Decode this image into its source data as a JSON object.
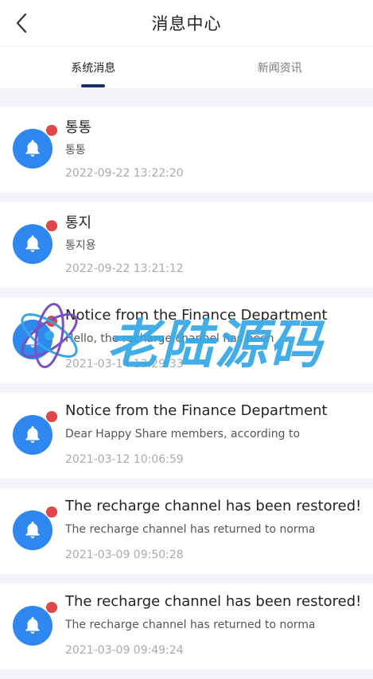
{
  "header": {
    "title": "消息中心",
    "back_icon": "chevron-left-icon"
  },
  "tabs": [
    {
      "label": "系统消息",
      "active": true
    },
    {
      "label": "新闻资讯",
      "active": false
    }
  ],
  "messages": [
    {
      "title": "통통",
      "preview": "통통",
      "time": "2022-09-22 13:22:20",
      "unread": true
    },
    {
      "title": "통지",
      "preview": "통지용",
      "time": "2022-09-22 13:21:12",
      "unread": true
    },
    {
      "title": "Notice from the Finance Department",
      "preview": "Hello, the recharge channel has been",
      "time": "2021-03-14 13:29:33",
      "unread": true
    },
    {
      "title": "Notice from the Finance Department",
      "preview": "Dear Happy Share members, according to",
      "time": "2021-03-12 10:06:59",
      "unread": true
    },
    {
      "title": "The recharge channel has been restored!",
      "preview": "The recharge channel has returned to normal",
      "time": "2021-03-09 09:50:28",
      "unread": true
    },
    {
      "title": "The recharge channel has been restored!",
      "preview": "The recharge channel has returned to normal",
      "time": "2021-03-09 09:49:24",
      "unread": true
    }
  ],
  "watermark": {
    "text": "老陆源码"
  },
  "colors": {
    "accent": "#2f87f0",
    "unread_dot": "#e04848",
    "tab_indicator": "#1d2c6f",
    "watermark": "#34a7e5"
  }
}
